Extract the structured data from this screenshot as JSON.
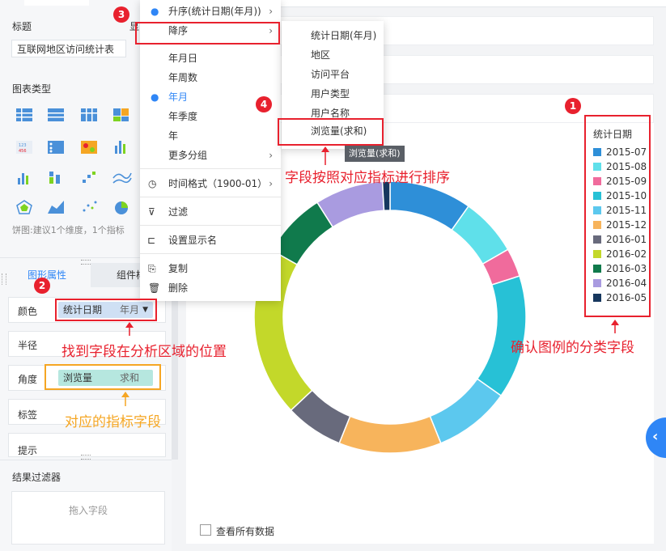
{
  "left_panel": {
    "title_label": "标题",
    "title_value": "互联网地区访问统计表",
    "chart_type_label": "图表类型",
    "pie_hint": "饼图:建议1个维度，1个指标",
    "tabs": [
      "图形属性",
      "组件样"
    ],
    "props": {
      "color_label": "颜色",
      "color_field": "统计日期",
      "color_field_sub": "年月",
      "radius_label": "半径",
      "angle_label": "角度",
      "angle_field": "浏览量",
      "angle_field_sub": "求和",
      "label_label": "标签",
      "tooltip_label": "提示"
    },
    "filter_label": "结果过滤器",
    "filter_drop": "拖入字段"
  },
  "partial_header_char": "显",
  "main_menu": {
    "items": [
      {
        "label": "升序(统计日期(年月))",
        "arrow": true,
        "bullet": true
      },
      {
        "label": "降序",
        "arrow": true
      },
      {
        "label": "年月日"
      },
      {
        "label": "年周数"
      },
      {
        "label": "年月",
        "bullet": true,
        "active": true
      },
      {
        "label": "年季度"
      },
      {
        "label": "年"
      },
      {
        "label": "更多分组",
        "arrow": true
      },
      {
        "label": "时间格式（1900-01）",
        "arrow": true
      },
      {
        "label": "过滤"
      },
      {
        "label": "设置显示名"
      },
      {
        "label": "复制"
      },
      {
        "label": "删除"
      }
    ]
  },
  "sub_menu": {
    "items": [
      "统计日期(年月)",
      "地区",
      "访问平台",
      "用户类型",
      "用户名称",
      "浏览量(求和)"
    ]
  },
  "tooltip": "浏览量(求和)",
  "annotations": {
    "a1": "字段按照对应指标进行排序",
    "a2": "找到字段在分析区域的位置",
    "a3": "对应的指标字段",
    "a4": "确认图例的分类字段",
    "badges": [
      "1",
      "2",
      "3",
      "4"
    ]
  },
  "legend": {
    "title": "统计日期",
    "items": [
      {
        "label": "2015-07",
        "color": "#2e8fd8"
      },
      {
        "label": "2015-08",
        "color": "#5fe0ea"
      },
      {
        "label": "2015-09",
        "color": "#f06b9c"
      },
      {
        "label": "2015-10",
        "color": "#27c1d6"
      },
      {
        "label": "2015-11",
        "color": "#5cc8ee"
      },
      {
        "label": "2015-12",
        "color": "#f7b45c"
      },
      {
        "label": "2016-01",
        "color": "#686a7c"
      },
      {
        "label": "2016-02",
        "color": "#c3d82a"
      },
      {
        "label": "2016-03",
        "color": "#107a4c"
      },
      {
        "label": "2016-04",
        "color": "#a99be0"
      },
      {
        "label": "2016-05",
        "color": "#17375e"
      }
    ]
  },
  "donut": {
    "segments": [
      {
        "value": 9.8,
        "color": "#2e8fd8"
      },
      {
        "value": 6.9,
        "color": "#5fe0ea"
      },
      {
        "value": 3.4,
        "color": "#f06b9c"
      },
      {
        "value": 14.7,
        "color": "#27c1d6"
      },
      {
        "value": 9.1,
        "color": "#5cc8ee"
      },
      {
        "value": 12.2,
        "color": "#f7b45c"
      },
      {
        "value": 6.9,
        "color": "#686a7c"
      },
      {
        "value": 20.2,
        "color": "#c3d82a"
      },
      {
        "value": 7.8,
        "color": "#107a4c"
      },
      {
        "value": 8.1,
        "color": "#a99be0"
      },
      {
        "value": 0.9,
        "color": "#17375e"
      }
    ]
  },
  "footer": {
    "show_all": "查看所有数据"
  }
}
